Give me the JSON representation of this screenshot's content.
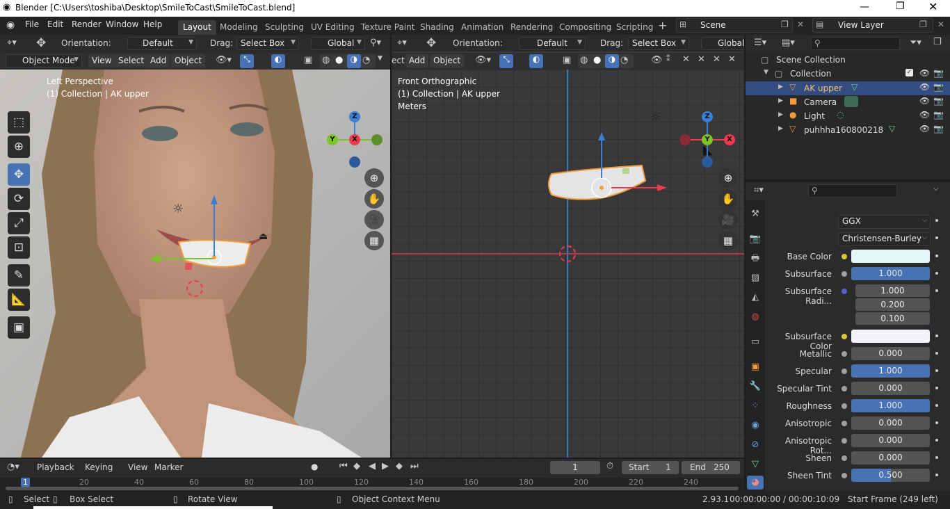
{
  "window": {
    "title": "Blender [C:\\Users\\toshiba\\Desktop\\SmileToCast\\SmileToCast.blend]"
  },
  "menus": [
    "File",
    "Edit",
    "Render",
    "Window",
    "Help"
  ],
  "workspaces": [
    "Layout",
    "Modeling",
    "Sculpting",
    "UV Editing",
    "Texture Paint",
    "Shading",
    "Animation",
    "Rendering",
    "Compositing",
    "Scripting"
  ],
  "workspace_add": "+",
  "scene": {
    "label": "Scene",
    "view_layer": "View Layer"
  },
  "left_viewport": {
    "orientation_label": "Orientation:",
    "orientation_value": "Default",
    "drag_label": "Drag:",
    "drag_value": "Select Box",
    "transform_space": "Global",
    "mode": "Object Mode",
    "menus": [
      "View",
      "Select",
      "Add",
      "Object"
    ],
    "overlay_title": "Left Perspective",
    "overlay_sub": "(1) Collection | AK upper",
    "gizmo": {
      "z": "Z",
      "y": "Y",
      "x": "X"
    }
  },
  "right_viewport": {
    "orientation_label": "Orientation:",
    "orientation_value": "Default",
    "drag_label": "Drag:",
    "drag_value": "Select Box",
    "transform_space": "Global",
    "menus_partial": "ect",
    "menus": [
      "Add",
      "Object"
    ],
    "overlay_title": "Front Orthographic",
    "overlay_sub": "(1) Collection | AK upper",
    "overlay_units": "Meters",
    "gizmo": {
      "z": "Z",
      "y": "Y",
      "x": "X"
    }
  },
  "outliner": {
    "root": "Scene Collection",
    "collection": "Collection",
    "items": [
      {
        "name": "AK upper",
        "selected": true
      },
      {
        "name": "Camera",
        "selected": false
      },
      {
        "name": "Light",
        "selected": false
      },
      {
        "name": "puhhha160800218",
        "selected": false
      }
    ]
  },
  "properties": {
    "distribution": "GGX",
    "subsurface_method": "Christensen-Burley",
    "rows": [
      {
        "label": "Base Color",
        "type": "color",
        "color": "#e4f6f6"
      },
      {
        "label": "Subsurface",
        "value": "1.000",
        "fill": 1.0
      },
      {
        "label": "Subsurface Radi...",
        "type": "vector",
        "values": [
          "1.000",
          "0.200",
          "0.100"
        ]
      },
      {
        "label": "Subsurface Color",
        "type": "color",
        "color": "#f4f4fa"
      },
      {
        "label": "Metallic",
        "value": "0.000",
        "fill": 0.0
      },
      {
        "label": "Specular",
        "value": "1.000",
        "fill": 1.0
      },
      {
        "label": "Specular Tint",
        "value": "0.000",
        "fill": 0.0
      },
      {
        "label": "Roughness",
        "value": "1.000",
        "fill": 1.0
      },
      {
        "label": "Anisotropic",
        "value": "0.000",
        "fill": 0.0
      },
      {
        "label": "Anisotropic Rot...",
        "value": "0.000",
        "fill": 0.0
      },
      {
        "label": "Sheen",
        "value": "0.000",
        "fill": 0.0
      },
      {
        "label": "Sheen Tint",
        "value": "0.500",
        "fill": 0.5
      }
    ]
  },
  "timeline": {
    "menus": [
      "Playback",
      "Keying",
      "View",
      "Marker"
    ],
    "current_frame": "1",
    "start_label": "Start",
    "start": "1",
    "end_label": "End",
    "end": "250",
    "ticks": [
      "1",
      "20",
      "40",
      "60",
      "80",
      "100",
      "120",
      "140",
      "160",
      "180",
      "200",
      "220",
      "240"
    ]
  },
  "status": {
    "select": "Select",
    "box_select": "Box Select",
    "rotate": "Rotate View",
    "context_menu": "Object Context Menu",
    "version": "2.93.1",
    "time": "00:00:00:00 / 00:00:10:09",
    "frames": "Start Frame (249 left)"
  },
  "colors": {
    "accent": "#4772b3",
    "selected_outline": "#f29b3a",
    "axis_x": "#ee3b4f",
    "axis_y": "#7ec428",
    "axis_z": "#3a7fd4"
  }
}
